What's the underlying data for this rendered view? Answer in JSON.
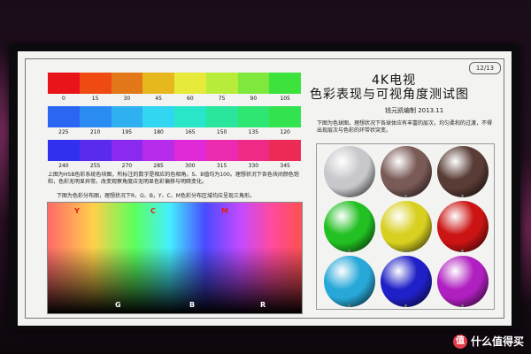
{
  "badge": "12/13",
  "title_line1": "4K电视",
  "title_line2": "色彩表现与可视角度测试图",
  "author": "钱元凯编制   2013.11",
  "rows": [
    {
      "labels": [
        "0",
        "15",
        "30",
        "45",
        "60",
        "75",
        "90",
        "105"
      ],
      "colors": [
        "#e8141a",
        "#ee4a12",
        "#e2781a",
        "#e6b81e",
        "#e7ea3a",
        "#b7ec3a",
        "#7ee83c",
        "#3ee23c"
      ]
    },
    {
      "labels": [
        "225",
        "210",
        "195",
        "180",
        "165",
        "150",
        "135",
        "120"
      ],
      "colors": [
        "#2a66f2",
        "#2a8cf2",
        "#2fb0f0",
        "#32d6f0",
        "#2ae6c8",
        "#2ae69c",
        "#2ee672",
        "#32e24e"
      ]
    },
    {
      "labels": [
        "240",
        "255",
        "270",
        "285",
        "300",
        "315",
        "330",
        "345"
      ],
      "colors": [
        "#3030ee",
        "#5a2aee",
        "#8b2aee",
        "#b62cea",
        "#e02ad8",
        "#ec2ab0",
        "#ee2a86",
        "#ec2a56"
      ]
    }
  ],
  "desc1": "上图为HSB色彩系统色块图，所标注的数字是相应的色相角。S、B值均为100。理想状况下各色块间颜色饱和，色彩无明显异常。改变观察角度应无明显色彩偏移与明暗变化。",
  "desc2": "下图为色彩分布图，理想状况下R、G、B，Y、C、M色彩分布区域均应呈现三角形。",
  "spectrum_top": [
    "Y",
    "C",
    "M"
  ],
  "spectrum_bottom": [
    "G",
    "B",
    "R"
  ],
  "sphere_desc": "下图为色球图，理想状况下各球体应有丰富的层次，均匀柔和的过渡，不得出现层次与色彩的环带状突变。",
  "spheres": [
    "#c8c8cc",
    "#7a5a56",
    "#5a3c36",
    "#22c022",
    "#d8d020",
    "#cc1414",
    "#28a8d8",
    "#2020c8",
    "#b020c0"
  ],
  "watermark": "什么值得买",
  "watermark_icon": "值"
}
